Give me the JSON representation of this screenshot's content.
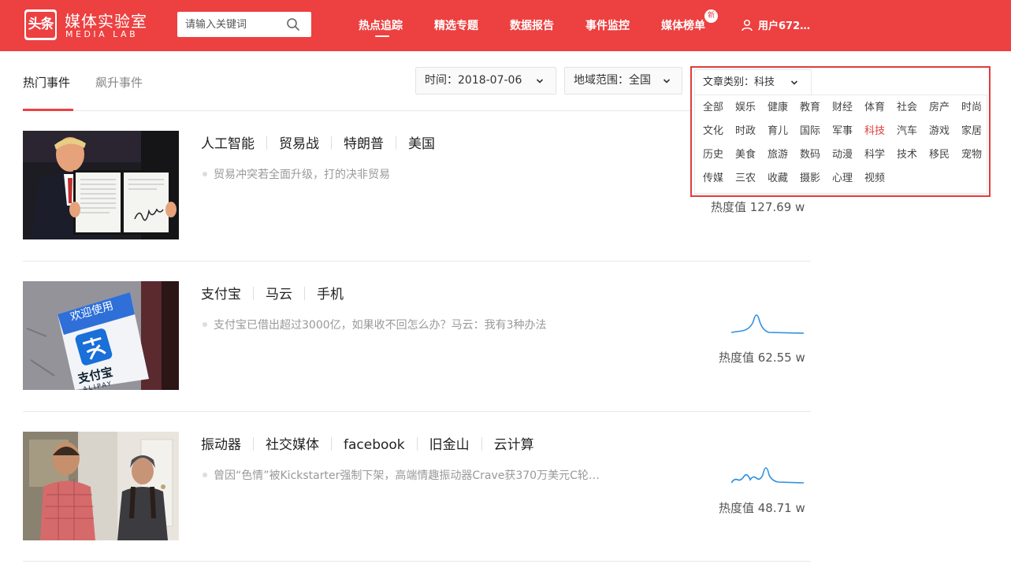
{
  "header": {
    "logo_text": "头条",
    "brand_cn": "媒体实验室",
    "brand_en": "MEDIA LAB",
    "search_placeholder": "请输入关键词",
    "nav": [
      "热点追踪",
      "精选专题",
      "数据报告",
      "事件监控",
      "媒体榜单"
    ],
    "new_badge": "新",
    "user": "用户672…"
  },
  "tabs": [
    "热门事件",
    "飙升事件"
  ],
  "filters": {
    "time": "时间：2018-07-06",
    "region": "地域范围：全国",
    "category": "文章类别：科技"
  },
  "categories": [
    [
      "全部",
      "娱乐",
      "健康",
      "教育",
      "财经",
      "体育",
      "社会",
      "房产",
      "时尚"
    ],
    [
      "文化",
      "时政",
      "育儿",
      "国际",
      "军事",
      "科技",
      "汽车",
      "游戏",
      "家居"
    ],
    [
      "历史",
      "美食",
      "旅游",
      "数码",
      "动漫",
      "科学",
      "技术",
      "移民",
      "宠物"
    ],
    [
      "传媒",
      "三农",
      "收藏",
      "摄影",
      "心理",
      "视频"
    ]
  ],
  "selected_category": "科技",
  "events": [
    {
      "tags": [
        "人工智能",
        "贸易战",
        "特朗普",
        "美国"
      ],
      "summary": "贸易冲突若全面升级，打的决非贸易",
      "heat": "热度值 127.69 w"
    },
    {
      "tags": [
        "支付宝",
        "马云",
        "手机"
      ],
      "summary": "支付宝已借出超过3000亿，如果收不回怎么办？马云：我有3种办法",
      "heat": "热度值 62.55 w",
      "image_text": [
        "欢迎使用",
        "支付宝",
        "ALIPAY"
      ]
    },
    {
      "tags": [
        "振动器",
        "社交媒体",
        "facebook",
        "旧金山",
        "云计算"
      ],
      "summary": "曾因“色情”被Kickstarter强制下架，高端情趣振动器Crave获370万美元C轮…",
      "heat": "热度值 48.71 w"
    }
  ],
  "colors": {
    "brand": "#ed4040",
    "selected": "#e03c3c",
    "sparkline": "#2f8fe0"
  }
}
